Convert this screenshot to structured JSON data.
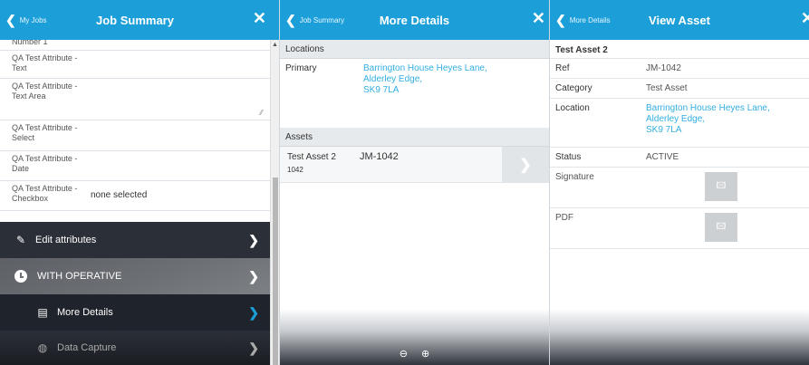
{
  "panel1": {
    "back_label": "My Jobs",
    "title": "Job Summary",
    "cut_label": "Number 1",
    "attributes": [
      {
        "label": "QA Test Attribute - Text",
        "value": ""
      },
      {
        "label": "QA Test Attribute - Text Area",
        "value": ""
      },
      {
        "label": "QA Test Attribute - Select",
        "value": ""
      },
      {
        "label": "QA Test Attribute - Date",
        "value": ""
      },
      {
        "label": "QA Test Attribute - Checkbox",
        "value": "none selected"
      }
    ],
    "menu": {
      "edit": "Edit attributes",
      "operative": "WITH OPERATIVE",
      "more": "More Details",
      "data": "Data Capture"
    }
  },
  "panel3": {
    "back_label": "Job Summary",
    "title": "More Details",
    "locations_header": "Locations",
    "primary_label": "Primary",
    "primary_address": [
      "Barrington House Heyes Lane,",
      "Alderley Edge,",
      "SK9 7LA"
    ],
    "assets_header": "Assets",
    "asset": {
      "name": "Test Asset 2",
      "id": "1042",
      "ref": "JM-1042"
    }
  },
  "panel4": {
    "back_label": "More Details",
    "title": "View Asset",
    "asset_title": "Test Asset 2",
    "ref_label": "Ref",
    "ref_value": "JM-1042",
    "category_label": "Category",
    "category_value": "Test Asset",
    "location_label": "Location",
    "location_value": [
      "Barrington House Heyes Lane,",
      "Alderley Edge,",
      "SK9 7LA"
    ],
    "status_label": "Status",
    "status_value": "ACTIVE",
    "signature_label": "Signature",
    "pdf_label": "PDF"
  },
  "colors": {
    "header": "#1c9fd8",
    "link": "#33aee2",
    "menu_dark": "#2b2f38"
  }
}
